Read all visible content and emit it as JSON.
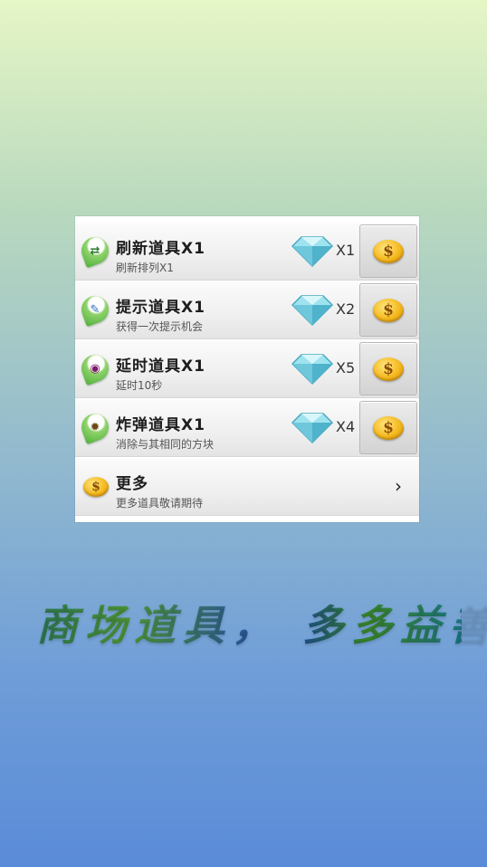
{
  "colors": {
    "coin": "#f4b91e",
    "diamond": "#7fd7e6",
    "leaf": "#4fae3c"
  },
  "shop": {
    "items": [
      {
        "title": "刷新道具X1",
        "desc": "刷新排列X1",
        "price": "X1",
        "icon": "refresh-icon",
        "glyph": "⇄"
      },
      {
        "title": "提示道具X1",
        "desc": "获得一次提示机会",
        "price": "X2",
        "icon": "hint-icon",
        "glyph": "✎"
      },
      {
        "title": "延时道具X1",
        "desc": "延时10秒",
        "price": "X5",
        "icon": "clock-icon",
        "glyph": "◉"
      },
      {
        "title": "炸弹道具X1",
        "desc": "消除与其相同的方块",
        "price": "X4",
        "icon": "bomb-icon",
        "glyph": "✹"
      }
    ],
    "more": {
      "title": "更多",
      "desc": "更多道具敬请期待",
      "coin_symbol": "$"
    },
    "buy_symbol": "$"
  },
  "slogan": "商场道具， 多多益善"
}
